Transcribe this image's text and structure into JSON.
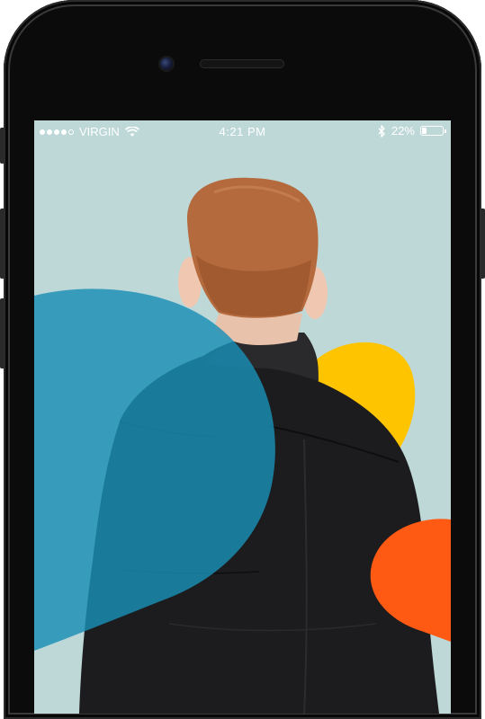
{
  "status_bar": {
    "carrier": "VIRGIN",
    "time": "4:21 PM",
    "battery_percent": "22%",
    "battery_level": 0.22,
    "signal_bars_filled": 4,
    "signal_bars_total": 5,
    "icons": [
      "wifi-icon",
      "bluetooth-icon",
      "battery-icon"
    ]
  },
  "screen": {
    "background_color": "#bdd8d7",
    "shapes": [
      {
        "name": "blue-blob",
        "color": "#1a8fb6"
      },
      {
        "name": "yellow-blob",
        "color": "#ffc400"
      },
      {
        "name": "orange-blob",
        "color": "#ff5a14"
      }
    ],
    "photo_subject": "person-back-black-leather-jacket"
  }
}
